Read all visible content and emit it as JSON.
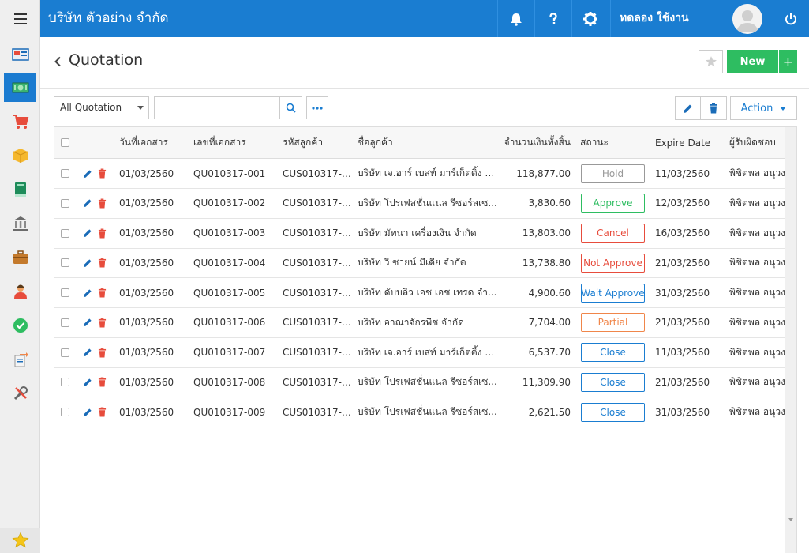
{
  "header": {
    "company_name": "บริษัท ตัวอย่าง จำกัด",
    "user_name": "ทดลอง ใช้งาน",
    "accent": "#1a7dd1"
  },
  "sidebar": {
    "items": [
      {
        "icon": "dashboard-icon",
        "active": false
      },
      {
        "icon": "money-icon",
        "active": true
      },
      {
        "icon": "cart-icon",
        "active": false
      },
      {
        "icon": "box-icon",
        "active": false
      },
      {
        "icon": "book-icon",
        "active": false
      },
      {
        "icon": "bank-icon",
        "active": false
      },
      {
        "icon": "briefcase-icon",
        "active": false
      },
      {
        "icon": "people-icon",
        "active": false
      },
      {
        "icon": "check-circle-icon",
        "active": false
      },
      {
        "icon": "document-export-icon",
        "active": false
      },
      {
        "icon": "tools-icon",
        "active": false
      },
      {
        "icon": "star-icon",
        "active": false
      }
    ]
  },
  "page": {
    "title": "Quotation",
    "new_label": "New",
    "plus_label": "+"
  },
  "toolbar": {
    "filter_value": "All Quotation",
    "search_value": "",
    "search_placeholder": "",
    "action_label": "Action"
  },
  "table": {
    "columns": [
      "วันที่เอกสาร",
      "เลขที่เอกสาร",
      "รหัสลูกค้า",
      "ชื่อลูกค้า",
      "จำนวนเงินทั้งสิ้น",
      "สถานะ",
      "Expire Date",
      "ผู้รับผิดชอบ"
    ],
    "rows": [
      {
        "date": "01/03/2560",
        "doc_no": "QU010317-001",
        "customer_code": "CUS010317-0...",
        "customer_name": "บริษัท เจ.อาร์ เบสท์ มาร์เก็ตติ้ง จำ...",
        "amount": "118,877.00",
        "status": "Hold",
        "status_color": "#999999",
        "expire": "11/03/2560",
        "owner": "พิชิตพล อนุวงศ์"
      },
      {
        "date": "01/03/2560",
        "doc_no": "QU010317-002",
        "customer_code": "CUS010317-0...",
        "customer_name": "บริษัท โปรเฟสชั่นแนล รีซอร์สเซ...",
        "amount": "3,830.60",
        "status": "Approve",
        "status_color": "#2ebd61",
        "expire": "12/03/2560",
        "owner": "พิชิตพล อนุวงศ์"
      },
      {
        "date": "01/03/2560",
        "doc_no": "QU010317-003",
        "customer_code": "CUS010317-0...",
        "customer_name": "บริษัท มัทนา เครื่องเงิน จำกัด",
        "amount": "13,803.00",
        "status": "Cancel",
        "status_color": "#e74c3c",
        "expire": "16/03/2560",
        "owner": "พิชิตพล อนุวงศ์"
      },
      {
        "date": "01/03/2560",
        "doc_no": "QU010317-004",
        "customer_code": "CUS010317-0...",
        "customer_name": "บริษัท วี ซายน์ มีเดีย จำกัด",
        "amount": "13,738.80",
        "status": "Not Approve",
        "status_color": "#e74c3c",
        "expire": "21/03/2560",
        "owner": "พิชิตพล อนุวงศ์"
      },
      {
        "date": "01/03/2560",
        "doc_no": "QU010317-005",
        "customer_code": "CUS010317-0...",
        "customer_name": "บริษัท ดับบลิว เอช เอช เทรด จำ...",
        "amount": "4,900.60",
        "status": "Wait Approve",
        "status_color": "#1a7dd1",
        "expire": "31/03/2560",
        "owner": "พิชิตพล อนุวงศ์"
      },
      {
        "date": "01/03/2560",
        "doc_no": "QU010317-006",
        "customer_code": "CUS010317-0...",
        "customer_name": "บริษัท อาณาจักรพืช จำกัด",
        "amount": "7,704.00",
        "status": "Partial",
        "status_color": "#f0864a",
        "expire": "21/03/2560",
        "owner": "พิชิตพล อนุวงศ์"
      },
      {
        "date": "01/03/2560",
        "doc_no": "QU010317-007",
        "customer_code": "CUS010317-0...",
        "customer_name": "บริษัท เจ.อาร์ เบสท์ มาร์เก็ตติ้ง จำ...",
        "amount": "6,537.70",
        "status": "Close",
        "status_color": "#1a7dd1",
        "expire": "11/03/2560",
        "owner": "พิชิตพล อนุวงศ์"
      },
      {
        "date": "01/03/2560",
        "doc_no": "QU010317-008",
        "customer_code": "CUS010317-0...",
        "customer_name": "บริษัท โปรเฟสชั่นแนล รีซอร์สเซ...",
        "amount": "11,309.90",
        "status": "Close",
        "status_color": "#1a7dd1",
        "expire": "21/03/2560",
        "owner": "พิชิตพล อนุวงศ์"
      },
      {
        "date": "01/03/2560",
        "doc_no": "QU010317-009",
        "customer_code": "CUS010317-0...",
        "customer_name": "บริษัท โปรเฟสชั่นแนล รีซอร์สเซ...",
        "amount": "2,621.50",
        "status": "Close",
        "status_color": "#1a7dd1",
        "expire": "31/03/2560",
        "owner": "พิชิตพล อนุวงศ์"
      }
    ]
  }
}
